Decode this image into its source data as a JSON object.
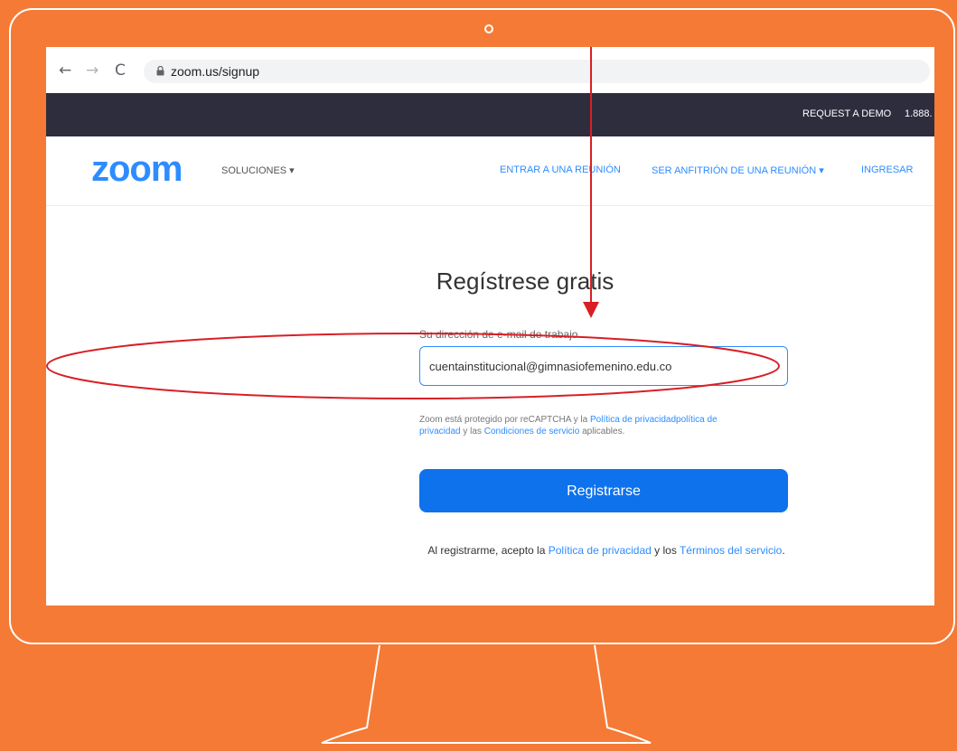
{
  "browser": {
    "back_icon": "arrow-left-icon",
    "forward_icon": "arrow-right-icon",
    "reload_icon": "reload-icon",
    "url": "zoom.us/signup"
  },
  "top_strip": {
    "request_demo": "REQUEST A DEMO",
    "phone": "1.888."
  },
  "zoom_nav": {
    "logo": "zoom",
    "solutions": "SOLUCIONES ▾",
    "join_meeting": "ENTRAR A UNA REUNIÓN",
    "host_meeting": "SER ANFITRIÓN DE UNA REUNIÓN ▾",
    "sign_in": "INGRESAR"
  },
  "signup": {
    "title": "Regístrese gratis",
    "email_label": "Su dirección de e-mail de trabajo",
    "email_value": "cuentainstitucional@gimnasiofemenino.edu.co",
    "captcha_pre": "Zoom está protegido por reCAPTCHA y la ",
    "captcha_link1": "Política de privacidadpolítica de privacidad",
    "captcha_mid": " y las ",
    "captcha_link2": "Condiciones de servicio",
    "captcha_post": " aplicables.",
    "register_button": "Registrarse",
    "legal_pre": "Al registrarme, acepto la ",
    "legal_link1": "Política de privacidad",
    "legal_mid": " y los ",
    "legal_link2": "Términos del servicio",
    "legal_post": "."
  },
  "colors": {
    "background": "#f57a36",
    "zoom_blue": "#2d8cff",
    "button_blue": "#0e72ed",
    "annotation_red": "#d81f26",
    "strip_dark": "#2d2d3e"
  }
}
